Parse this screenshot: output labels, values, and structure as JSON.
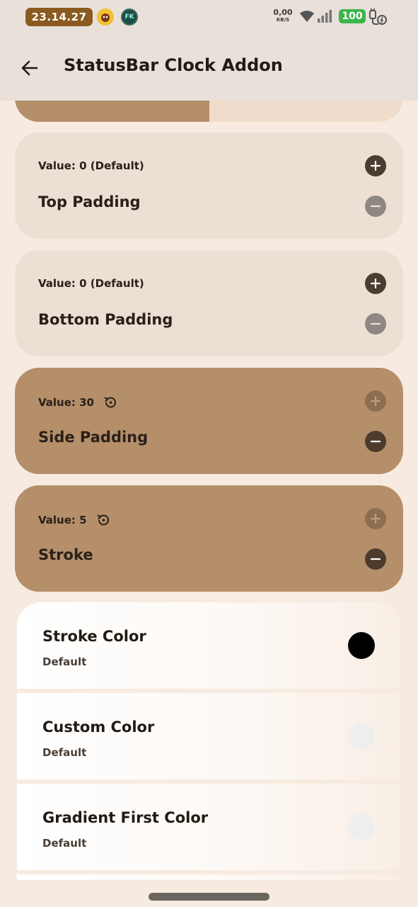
{
  "status_bar": {
    "clock": "23.14.27",
    "notif_a_label": "",
    "notif_b_label": "FK",
    "net_speed_value": "0,00",
    "net_speed_unit": "KB/S",
    "battery": "100"
  },
  "app_bar": {
    "title": "StatusBar Clock Addon"
  },
  "partial_slider": {
    "fill_fraction": 0.5
  },
  "cards": [
    {
      "value": "Value: 0 (Default)",
      "title": "Top Padding",
      "active": false,
      "reset_icon": false
    },
    {
      "value": "Value: 0 (Default)",
      "title": "Bottom Padding",
      "active": false,
      "reset_icon": false
    },
    {
      "value": "Value: 30",
      "title": "Side Padding",
      "active": true,
      "reset_icon": true
    },
    {
      "value": "Value: 5",
      "title": "Stroke",
      "active": true,
      "reset_icon": true
    }
  ],
  "list_items": [
    {
      "title": "Stroke Color",
      "subtitle": "Default",
      "swatch_color": "#000000"
    },
    {
      "title": "Custom Color",
      "subtitle": "Default",
      "swatch_color": "#eeeeee"
    },
    {
      "title": "Gradient First Color",
      "subtitle": "Default",
      "swatch_color": "#eeeeee"
    }
  ],
  "colors": {
    "accent": "#b58f6a",
    "card_bg": "#ecdfd3",
    "app_bar_bg": "#e9e0da",
    "battery_green": "#3bb54a",
    "clock_pill": "#8a5a1f"
  }
}
